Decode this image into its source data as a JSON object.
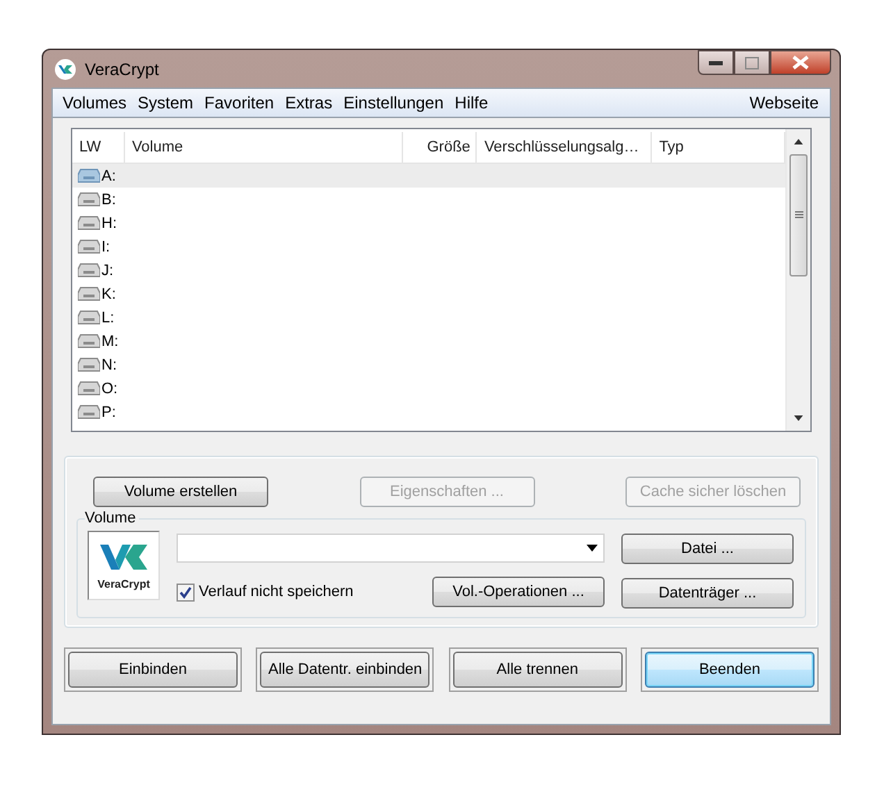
{
  "window": {
    "title": "VeraCrypt"
  },
  "menu": [
    {
      "label": "Volumes"
    },
    {
      "label": "System"
    },
    {
      "label": "Favoriten"
    },
    {
      "label": "Extras"
    },
    {
      "label": "Einstellungen"
    },
    {
      "label": "Hilfe"
    }
  ],
  "menu_right": {
    "label": "Webseite"
  },
  "table": {
    "columns": [
      "LW",
      "Volume",
      "Größe",
      "Verschlüsselungsalg…",
      "Typ"
    ],
    "rows": [
      {
        "drive": "A:",
        "selected": true
      },
      {
        "drive": "B:",
        "selected": false
      },
      {
        "drive": "H:",
        "selected": false
      },
      {
        "drive": "I:",
        "selected": false
      },
      {
        "drive": "J:",
        "selected": false
      },
      {
        "drive": "K:",
        "selected": false
      },
      {
        "drive": "L:",
        "selected": false
      },
      {
        "drive": "M:",
        "selected": false
      },
      {
        "drive": "N:",
        "selected": false
      },
      {
        "drive": "O:",
        "selected": false
      },
      {
        "drive": "P:",
        "selected": false
      }
    ]
  },
  "action_buttons": [
    {
      "label": "Volume erstellen",
      "disabled": false
    },
    {
      "label": "Eigenschaften ...",
      "disabled": true
    },
    {
      "label": "Cache sicher löschen",
      "disabled": true
    }
  ],
  "volume_group": {
    "title": "Volume",
    "logo_text": "VeraCrypt",
    "history_checkbox": {
      "label": "Verlauf nicht speichern",
      "checked": true
    },
    "buttons": [
      {
        "label": "Datei ..."
      },
      {
        "label": "Vol.-Operationen ..."
      },
      {
        "label": "Datenträger ..."
      }
    ]
  },
  "bottom_buttons": [
    {
      "label": "Einbinden",
      "default": false
    },
    {
      "label": "Alle Datentr. einbinden",
      "default": false
    },
    {
      "label": "Alle trennen",
      "default": false
    },
    {
      "label": "Beenden",
      "default": true
    }
  ]
}
